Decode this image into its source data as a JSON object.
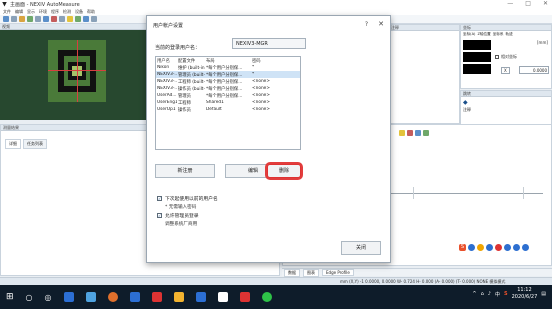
{
  "window": {
    "title": "主画面 - NEXIV AutoMeasure",
    "controls": [
      "—",
      "□",
      "✕"
    ]
  },
  "menu": [
    "文件",
    "编辑",
    "显示",
    "环境",
    "程序",
    "检测",
    "设备",
    "帮助"
  ],
  "panels": {
    "camera_header": "视频",
    "lower_left_header": "测量结果",
    "lower_left_tabs": [
      "详细",
      "任务列表"
    ],
    "right_top_header": "注释",
    "dro_header": "坐标",
    "dro_tabs": [
      "坐标(A)",
      "Z轴位置",
      "坐标系",
      "轨迹"
    ],
    "dro_unit": "[mm]",
    "dro_values": [
      "",
      "",
      ""
    ],
    "dro_check_label": "相对坐标",
    "dro_axis": "X",
    "dro_field": "0.0000",
    "right_mid_header": "跳转",
    "right_mid_label": "注释"
  },
  "graph": {
    "bottom_tabs": [
      "数据",
      "图表",
      "Edge Profile"
    ]
  },
  "status": {
    "text": "mm  (X,Y) -1  0.0000, 0.0000  W-  0.724  H-  0.000  (A-  0.000)  (T-  0.000)  NONE  模拟模式"
  },
  "taskbar": {
    "time": "11:12",
    "date": "2020/6/27",
    "ime": "中",
    "tray_arrow": "^"
  },
  "dialog": {
    "title": "用户帐户设置",
    "help": "?",
    "close": "✕",
    "current_user_label": "当前的登录用户名：",
    "current_user_value": "NEXIV3-MGR",
    "columns": [
      "用户名",
      "配置文件",
      "布局",
      "密码"
    ],
    "rows": [
      {
        "user": "Nikon",
        "profile": "维护 (built-in)",
        "layout": "*每个用户分别保...",
        "password": "*"
      },
      {
        "user": "NEXIV3-...",
        "profile": "管理员 (built-in)",
        "layout": "*每个用户分别保...",
        "password": "*"
      },
      {
        "user": "NEXIV3-...",
        "profile": "工程师 (built-in)",
        "layout": "*每个用户分别保...",
        "password": "<none>"
      },
      {
        "user": "NEXIV3-...",
        "profile": "操作员 (built-in)",
        "layout": "*每个用户分别保...",
        "password": "<none>"
      },
      {
        "user": "UserAd...",
        "profile": "管理员",
        "layout": "*每个用户分别保...",
        "password": "<none>"
      },
      {
        "user": "UserEng1",
        "profile": "工程师",
        "layout": "Shared1",
        "password": "<none>"
      },
      {
        "user": "UserOp1",
        "profile": "操作员",
        "layout": "Default",
        "password": "<none>"
      }
    ],
    "selected_row": 1,
    "buttons": {
      "new": "新注册",
      "edit": "编辑",
      "delete": "删除",
      "close": "关闭"
    },
    "checkbox_1": "下次起使用以前的用户名",
    "checkbox_1_note": "* 无需输入密码",
    "checkbox_2": "允许管理员登录",
    "checkbox_2_note": "调整系统厂商用"
  },
  "colors": {
    "dro_text": "#2aff44",
    "highlight": "#e23d3d",
    "taskbar": "#0e1c2a"
  }
}
